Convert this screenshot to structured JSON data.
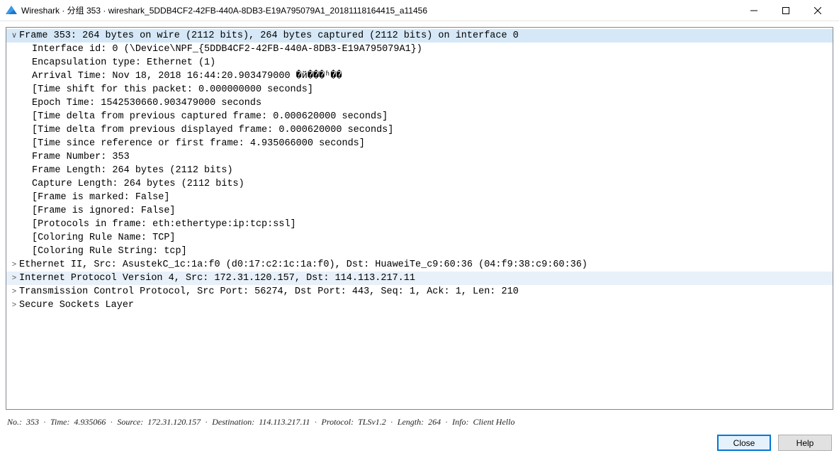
{
  "window": {
    "title": "Wireshark · 分组 353 · wireshark_5DDB4CF2-42FB-440A-8DB3-E19A795079A1_20181118164415_a11456"
  },
  "tree": {
    "frame": {
      "header": "Frame 353: 264 bytes on wire (2112 bits), 264 bytes captured (2112 bits) on interface 0",
      "children": [
        "Interface id: 0 (\\Device\\NPF_{5DDB4CF2-42FB-440A-8DB3-E19A795079A1})",
        "Encapsulation type: Ethernet (1)",
        "Arrival Time: Nov 18, 2018 16:44:20.903479000 �й���ʱ��",
        "[Time shift for this packet: 0.000000000 seconds]",
        "Epoch Time: 1542530660.903479000 seconds",
        "[Time delta from previous captured frame: 0.000620000 seconds]",
        "[Time delta from previous displayed frame: 0.000620000 seconds]",
        "[Time since reference or first frame: 4.935066000 seconds]",
        "Frame Number: 353",
        "Frame Length: 264 bytes (2112 bits)",
        "Capture Length: 264 bytes (2112 bits)",
        "[Frame is marked: False]",
        "[Frame is ignored: False]",
        "[Protocols in frame: eth:ethertype:ip:tcp:ssl]",
        "[Coloring Rule Name: TCP]",
        "[Coloring Rule String: tcp]"
      ]
    },
    "collapsed": [
      "Ethernet II, Src: AsustekC_1c:1a:f0 (d0:17:c2:1c:1a:f0), Dst: HuaweiTe_c9:60:36 (04:f9:38:c9:60:36)",
      "Internet Protocol Version 4, Src: 172.31.120.157, Dst: 114.113.217.11",
      "Transmission Control Protocol, Src Port: 56274, Dst Port: 443, Seq: 1, Ack: 1, Len: 210",
      "Secure Sockets Layer"
    ]
  },
  "status": {
    "no_label": "No.:",
    "no": "353",
    "time_label": "Time:",
    "time": "4.935066",
    "source_label": "Source:",
    "source": "172.31.120.157",
    "dest_label": "Destination:",
    "dest": "114.113.217.11",
    "proto_label": "Protocol:",
    "proto": "TLSv1.2",
    "len_label": "Length:",
    "len": "264",
    "info_label": "Info:",
    "info": "Client Hello"
  },
  "buttons": {
    "close": "Close",
    "help": "Help"
  }
}
